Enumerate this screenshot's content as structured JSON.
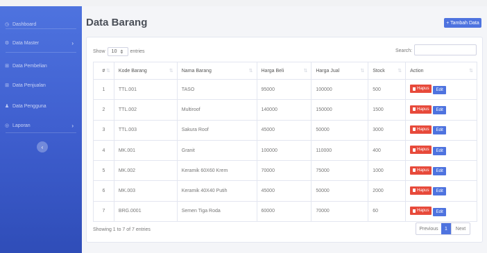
{
  "sidebar": {
    "items": [
      {
        "label": "Dashboard",
        "icon": "dashboard-icon",
        "glyph": "◷",
        "chevron": ""
      },
      {
        "label": "Data Master",
        "icon": "cog-icon",
        "glyph": "⚙",
        "chevron": "›"
      },
      {
        "label": "Data Pembelian",
        "icon": "cart-icon",
        "glyph": "⊞",
        "chevron": ""
      },
      {
        "label": "Data Penjualan",
        "icon": "cart-icon",
        "glyph": "⊞",
        "chevron": ""
      },
      {
        "label": "Data Pengguna",
        "icon": "user-icon",
        "glyph": "♟",
        "chevron": ""
      },
      {
        "label": "Laporan",
        "icon": "report-icon",
        "glyph": "◎",
        "chevron": "›"
      }
    ],
    "toggle_glyph": "‹"
  },
  "header": {
    "title": "Data Barang",
    "add_button": "+ Tambah Data"
  },
  "table_controls": {
    "show_label": "Show",
    "entries_value": "10",
    "entries_label": "entries",
    "search_label": "Search:",
    "search_value": ""
  },
  "table": {
    "columns": [
      "#",
      "Kode Barang",
      "Nama Barang",
      "Harga Beli",
      "Harga Jual",
      "Stock",
      "Action"
    ],
    "rows": [
      [
        "1",
        "TTL.001",
        "TASO",
        "95000",
        "100000",
        "500"
      ],
      [
        "2",
        "TTL.002",
        "Multiroof",
        "140000",
        "150000",
        "1500"
      ],
      [
        "3",
        "TTL.003",
        "Sakura Roof",
        "45000",
        "50000",
        "3000"
      ],
      [
        "4",
        "MK.001",
        "Granit",
        "100000",
        "110000",
        "400"
      ],
      [
        "5",
        "MK.002",
        "Keramik 60X60 Krem",
        "70000",
        "75000",
        "1000"
      ],
      [
        "6",
        "MK.003",
        "Keramik 40X40 Putih",
        "45000",
        "50000",
        "2000"
      ],
      [
        "7",
        "BRG.0001",
        "Semen Tiga Roda",
        "60000",
        "70000",
        "60"
      ]
    ],
    "delete_label": "Hapus",
    "edit_label": "Edit"
  },
  "footer": {
    "info": "Showing 1 to 7 of 7 entries",
    "prev": "Previous",
    "page": "1",
    "next": "Next"
  },
  "colors": {
    "primary": "#4e73df",
    "danger": "#e74a3b",
    "sidebar_top": "#4e73df",
    "sidebar_bottom": "#2f4db8"
  }
}
